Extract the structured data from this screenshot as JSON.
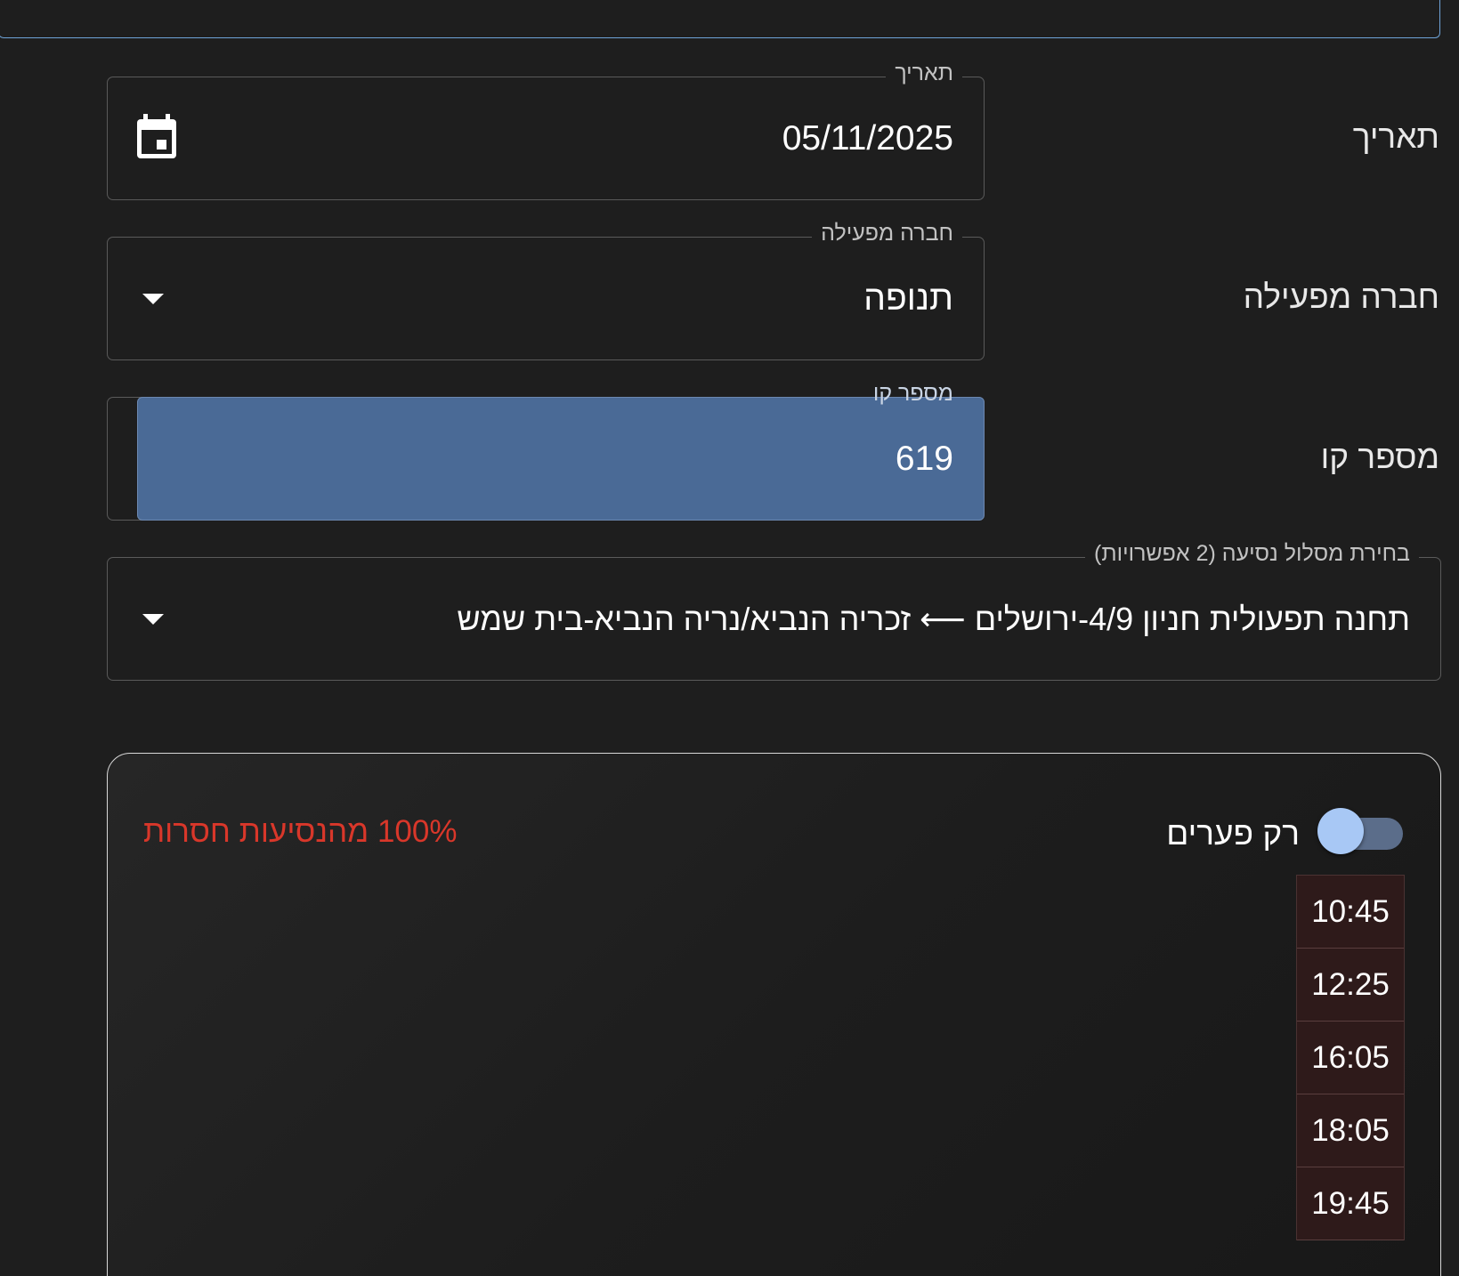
{
  "form": {
    "date": {
      "row_label": "תאריך",
      "legend": "תאריך",
      "value": "05/11/2025",
      "icon": "calendar-icon"
    },
    "company": {
      "row_label": "חברה מפעילה",
      "legend": "חברה מפעילה",
      "value": "תנופה",
      "icon": "dropdown-arrow-icon"
    },
    "line": {
      "row_label": "מספר קו",
      "legend": "מספר קו",
      "value": "619"
    },
    "route": {
      "legend": "בחירת מסלול נסיעה (2 אפשרויות)",
      "value": "תחנה תפעולית חניון 4/9-ירושלים ⟵ זכריה הנביא/נריה הנביא-בית שמש",
      "icon": "dropdown-arrow-icon"
    }
  },
  "results": {
    "missing_summary": "100% מהנסיעות חסרות",
    "gaps_toggle": {
      "label": "רק פערים",
      "checked": true
    },
    "trip_times": [
      "10:45",
      "12:25",
      "16:05",
      "18:05",
      "19:45"
    ]
  },
  "colors": {
    "background": "#1e1e1e",
    "accent_blue": "#4a6a96",
    "missing_red": "#d9372a",
    "missing_cell": "#2e1a1a",
    "toggle_thumb": "#a8c8f5"
  }
}
